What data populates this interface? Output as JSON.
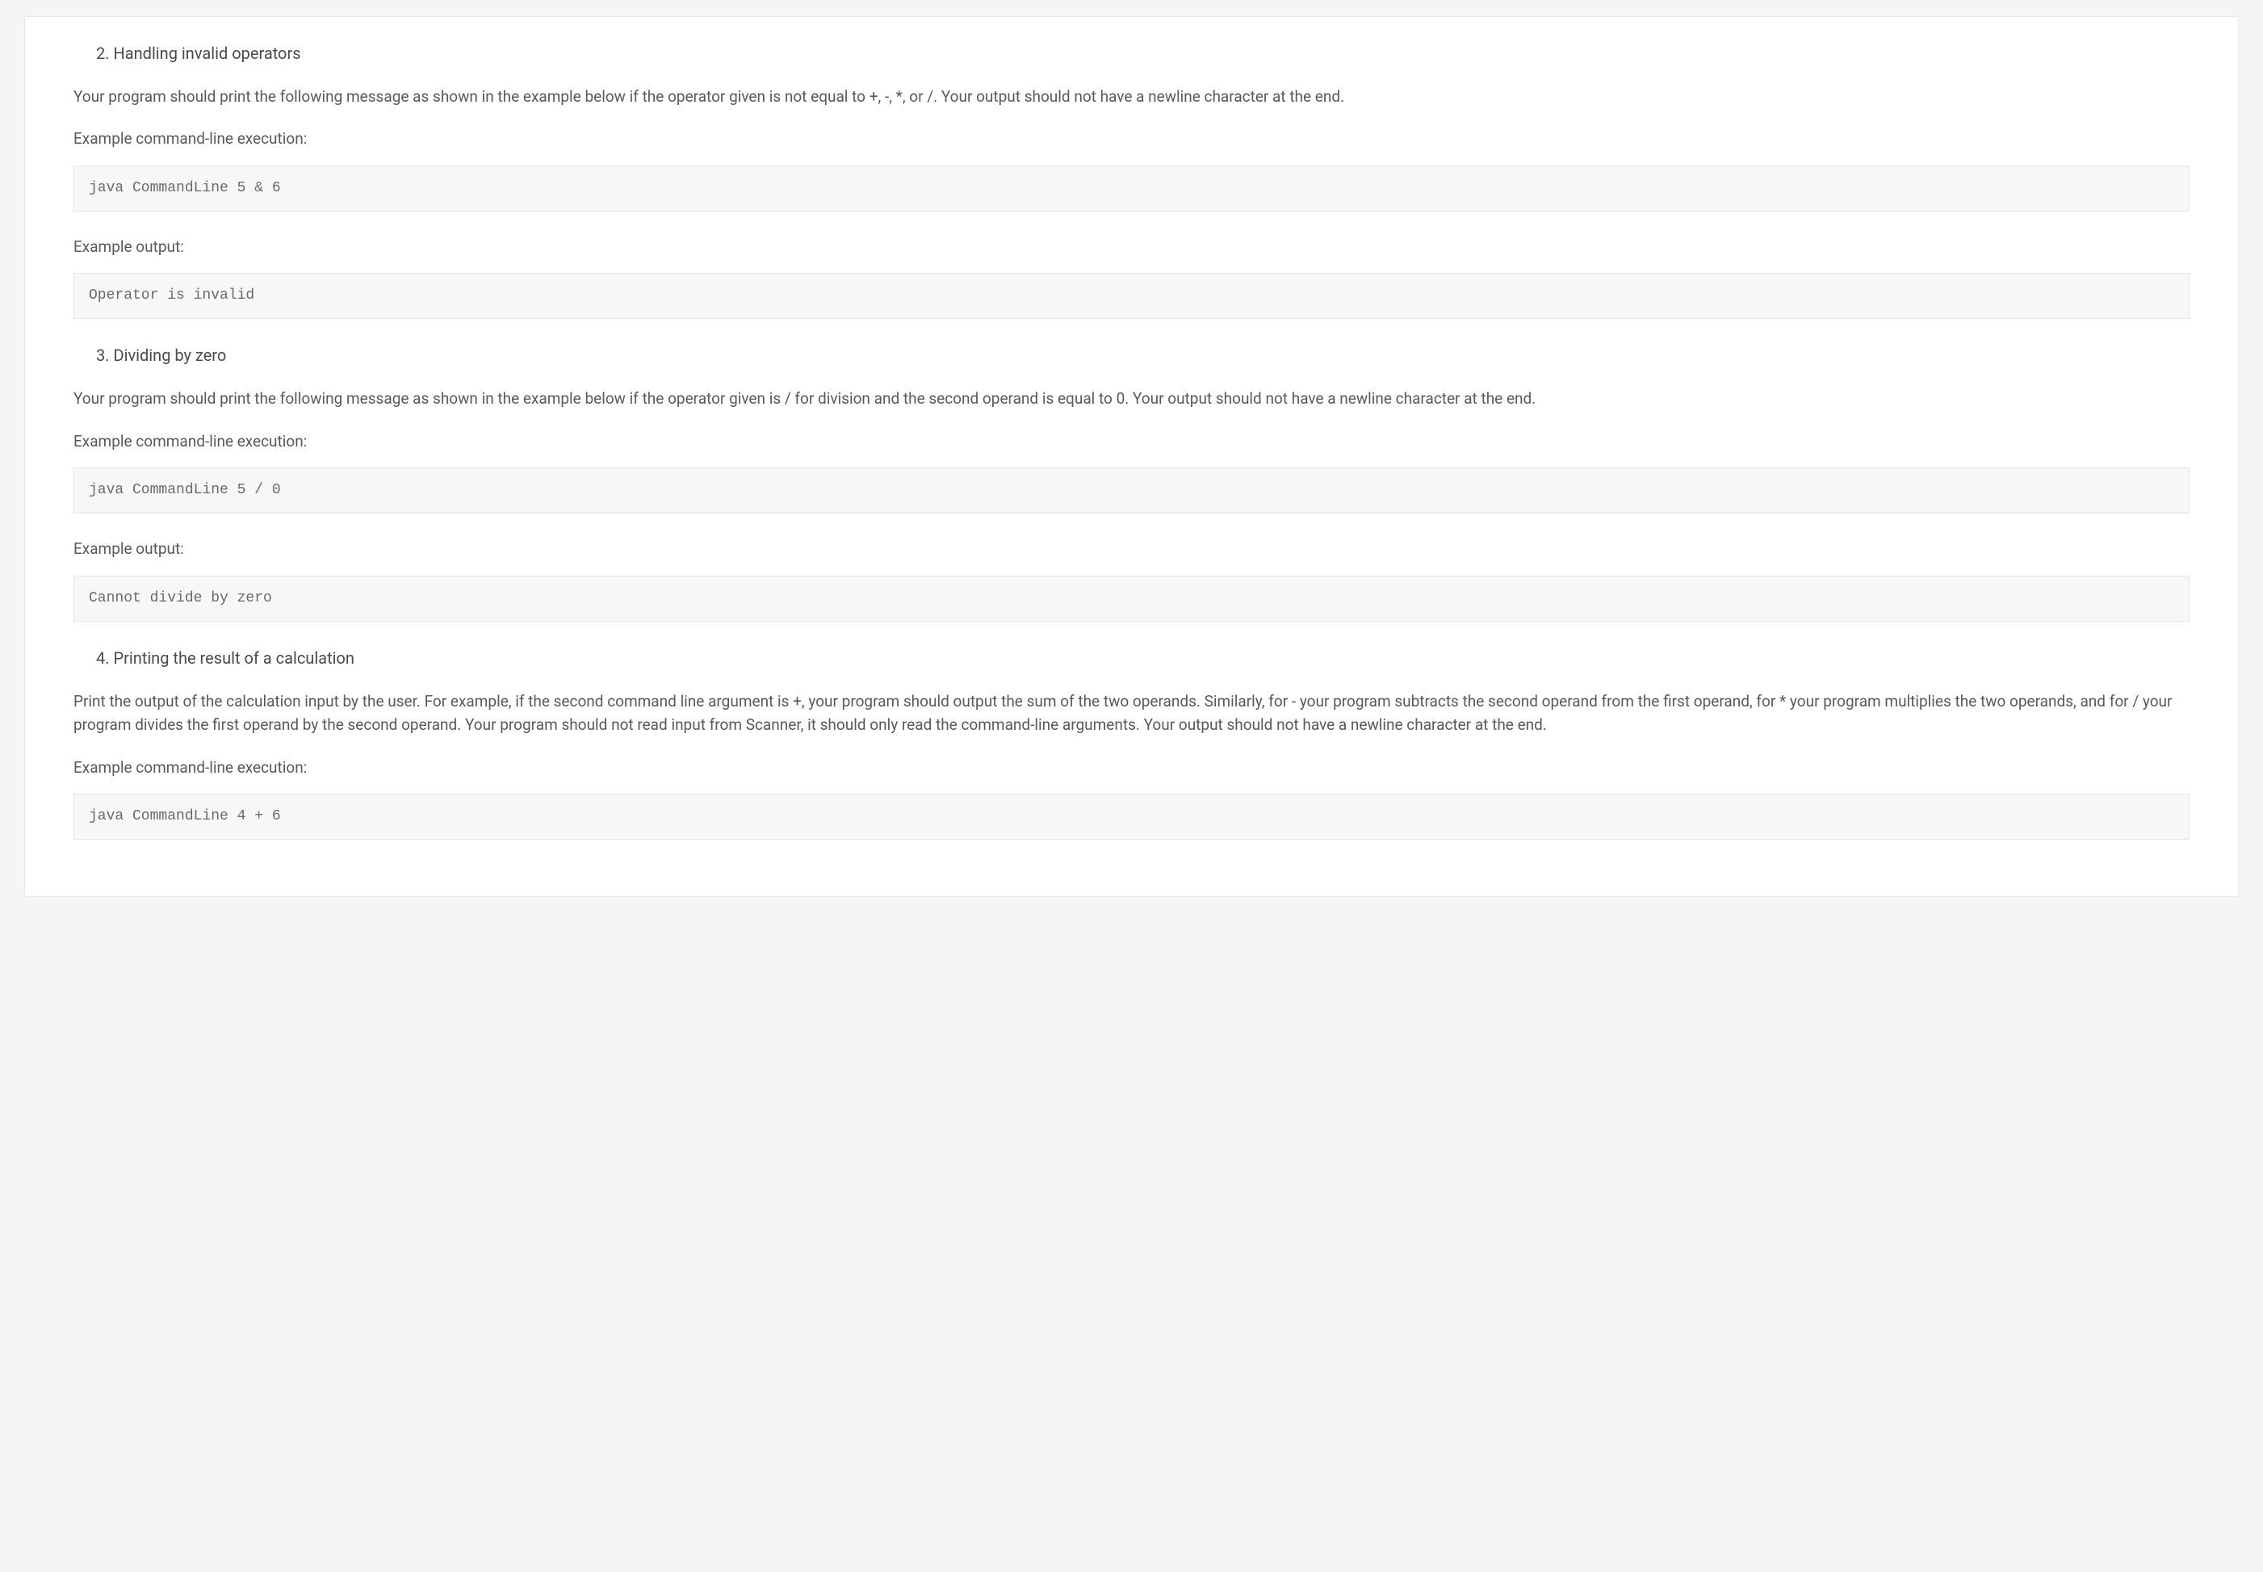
{
  "sections": [
    {
      "heading": "2. Handling invalid operators",
      "description": "Your program should print the following message as shown in the example below if the operator given is not equal to +, -, *, or /. Your output should not have a newline character at the end.",
      "exec_label": "Example command-line execution:",
      "exec_code": "java CommandLine 5 & 6",
      "output_label": "Example output:",
      "output_code": "Operator is invalid"
    },
    {
      "heading": "3. Dividing by zero",
      "description": "Your program should print the following message as shown in the example below if the operator given is / for division and the second operand is equal to 0. Your output should not have a newline character at the end.",
      "exec_label": "Example command-line execution:",
      "exec_code": "java CommandLine 5 / 0",
      "output_label": "Example output:",
      "output_code": "Cannot divide by zero"
    },
    {
      "heading": "4. Printing the result of a calculation",
      "description": "Print the output of the calculation input by the user. For example, if the second command line argument is +, your program should output the sum of the two operands. Similarly, for - your program subtracts the second operand from the first operand, for * your program multiplies the two operands, and for / your program divides the first operand by the second operand. Your program should not read input from Scanner, it should only read the command-line arguments. Your output should not have a newline character at the end.",
      "exec_label": "Example command-line execution:",
      "exec_code": "java CommandLine 4 + 6",
      "output_label": null,
      "output_code": null
    }
  ]
}
